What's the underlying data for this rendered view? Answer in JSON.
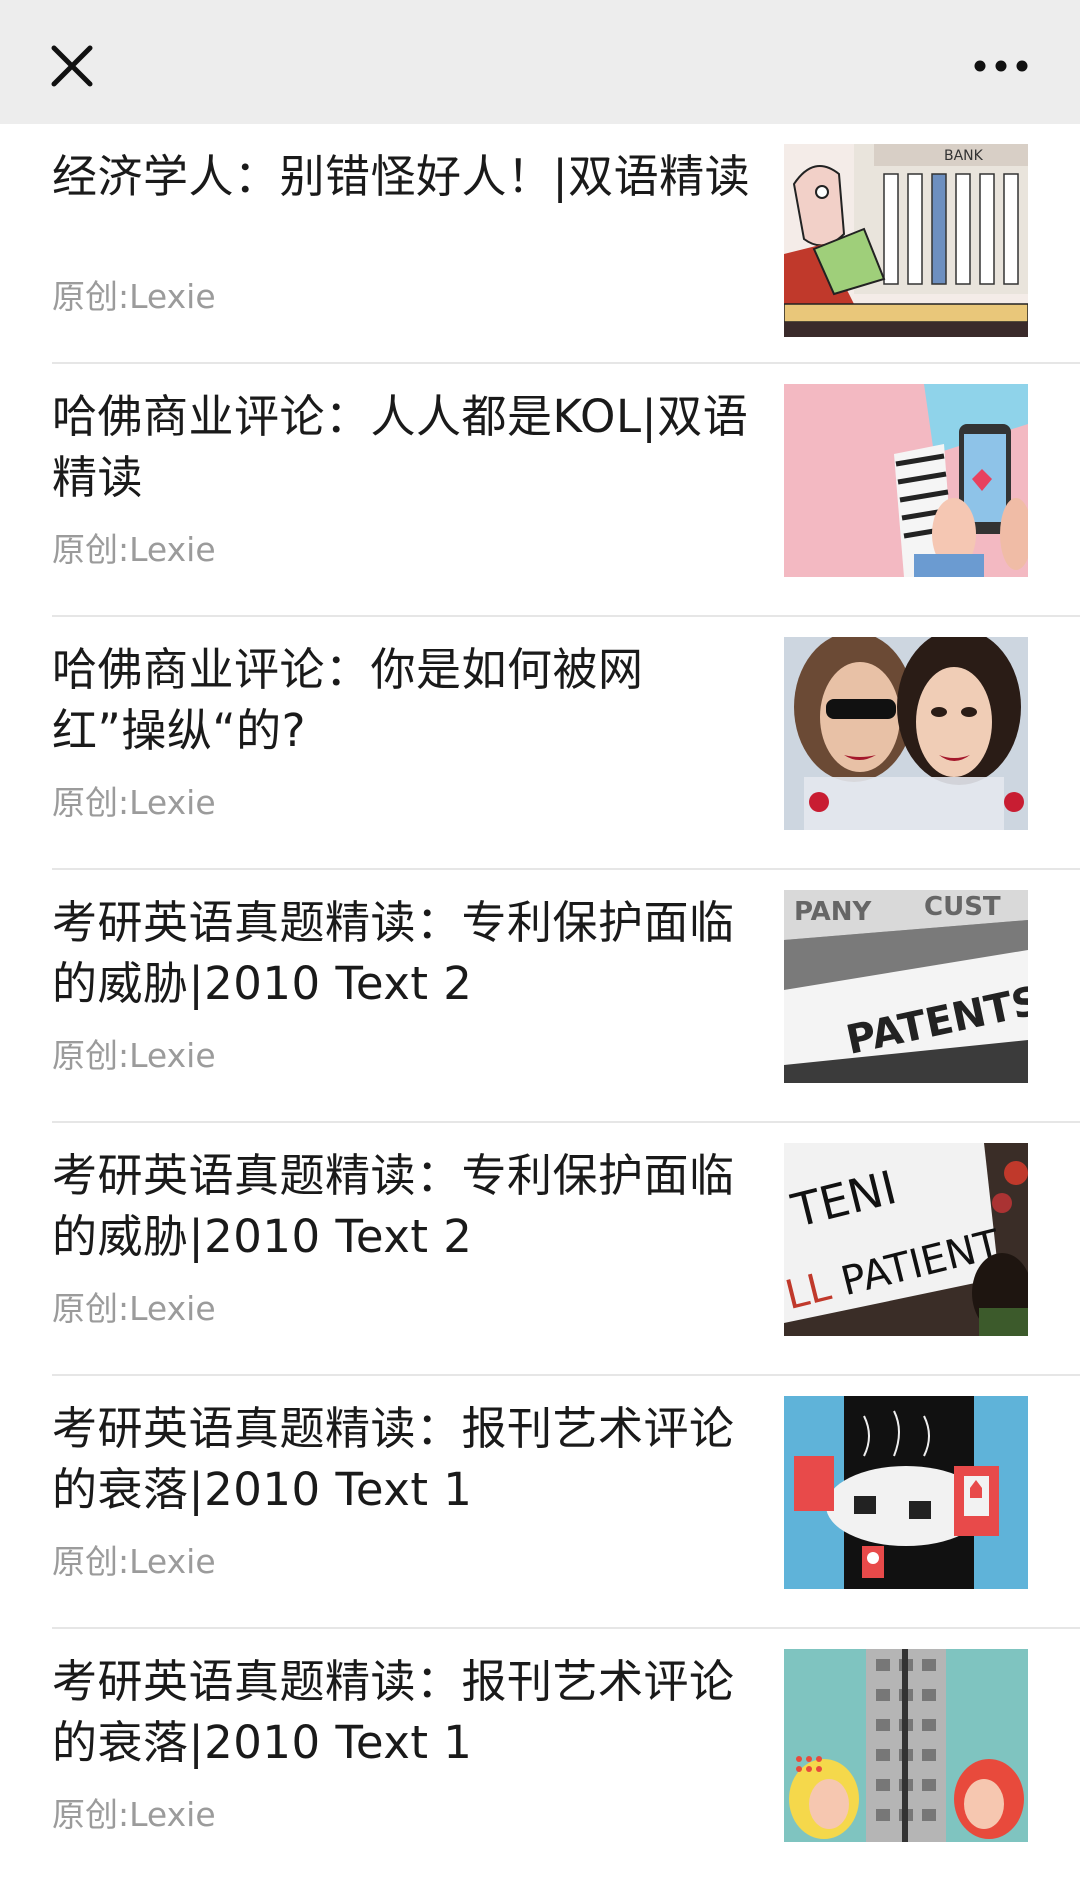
{
  "nav": {
    "close_icon": "close-icon",
    "more_icon": "more-icon"
  },
  "articles": [
    {
      "title": "经济学人：别错怪好人！|双语精读",
      "author": "原创:Lexie",
      "thumbnail": "bank-cartoon-image"
    },
    {
      "title": "哈佛商业评论：人人都是KOL|双语精读",
      "author": "原创:Lexie",
      "thumbnail": "smartphone-pink-image"
    },
    {
      "title": "哈佛商业评论：你是如何被网红”操纵“的?",
      "author": "原创:Lexie",
      "thumbnail": "influencers-selfie-image"
    },
    {
      "title": "考研英语真题精读：专利保护面临的威胁|2010 Text 2",
      "author": "原创:Lexie",
      "thumbnail": "patents-folder-image"
    },
    {
      "title": "考研英语真题精读：专利保护面临的威胁|2010 Text 2",
      "author": "原创:Lexie",
      "thumbnail": "patient-protest-image"
    },
    {
      "title": "考研英语真题精读：报刊艺术评论的衰落|2010 Text 1",
      "author": "原创:Lexie",
      "thumbnail": "art-review-illustration-image"
    },
    {
      "title": "考研英语真题精读：报刊艺术评论的衰落|2010 Text 1",
      "author": "原创:Lexie",
      "thumbnail": "art-review-comic-image"
    }
  ]
}
